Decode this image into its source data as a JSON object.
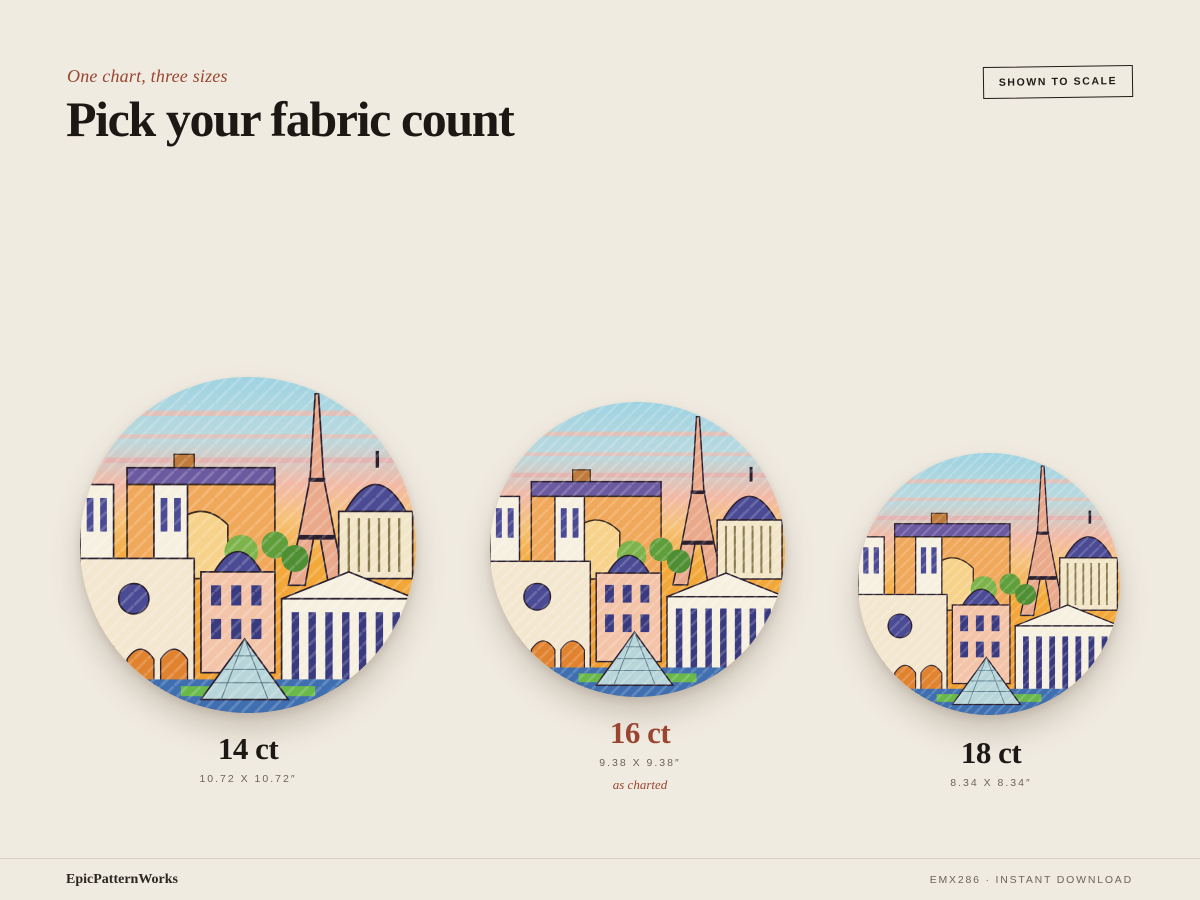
{
  "header": {
    "eyebrow": "One chart, three sizes",
    "title": "Pick your fabric count",
    "badge": "SHOWN TO SCALE"
  },
  "sizes": [
    {
      "count": "14 ct",
      "dimensions": "10.72 X 10.72″",
      "note": ""
    },
    {
      "count": "16 ct",
      "dimensions": "9.38 X 9.38″",
      "note": "as charted"
    },
    {
      "count": "18 ct",
      "dimensions": "8.34 X 8.34″",
      "note": ""
    }
  ],
  "footer": {
    "brand": "EpicPatternWorks",
    "sku": "EMX286 · INSTANT DOWNLOAD"
  },
  "colors": {
    "accent": "#9a4530",
    "background": "#f0ebe1",
    "text": "#1f1b16"
  }
}
